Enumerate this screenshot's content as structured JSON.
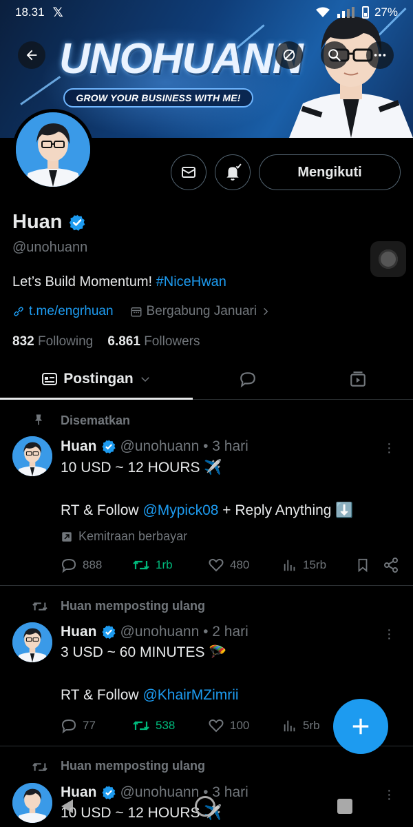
{
  "status_bar": {
    "time": "18.31",
    "app_glyph": "𝕏",
    "battery": "27%"
  },
  "banner": {
    "title": "UNOHUANN",
    "tagline": "GROW YOUR BUSINESS WITH ME!"
  },
  "profile": {
    "name": "Huan",
    "handle": "@unohuann",
    "bio_text": "Let’s Build Momentum! ",
    "bio_hashtag": "#NiceHwan",
    "link": "t.me/engrhuan",
    "joined": "Bergabung Januari",
    "following_count": "832",
    "following_label": "Following",
    "followers_count": "6.861",
    "followers_label": "Followers",
    "follow_button": "Mengikuti"
  },
  "tabs": {
    "active_label": "Postingan"
  },
  "posts": [
    {
      "context": "Disematkan",
      "name": "Huan",
      "handle_time": "@unohuann • 3 hari",
      "line1": "10 USD ~ 12 HOURS ✈️",
      "line2_pre": "RT & Follow ",
      "line2_mention": "@Mypick08",
      "line2_post": " + Reply Anything ⬇️",
      "paid": "Kemitraan berbayar",
      "replies": "888",
      "reposts": "1rb",
      "likes": "480",
      "views": "15rb"
    },
    {
      "context": "Huan memposting ulang",
      "name": "Huan",
      "handle_time": "@unohuann • 2 hari",
      "line1": "3 USD ~ 60 MINUTES 🪂",
      "line2_pre": "RT & Follow ",
      "line2_mention": "@KhairMZimrii",
      "replies": "77",
      "reposts": "538",
      "likes": "100",
      "views": "5rb"
    },
    {
      "context": "Huan memposting ulang",
      "name": "Huan",
      "handle_time": "@unohuann • 3 hari",
      "line1": "10 USD ~ 12 HOURS ✈️"
    }
  ],
  "colors": {
    "accent": "#1d9bf0",
    "repost": "#00ba7c",
    "muted": "#71767b",
    "background": "#000000"
  }
}
